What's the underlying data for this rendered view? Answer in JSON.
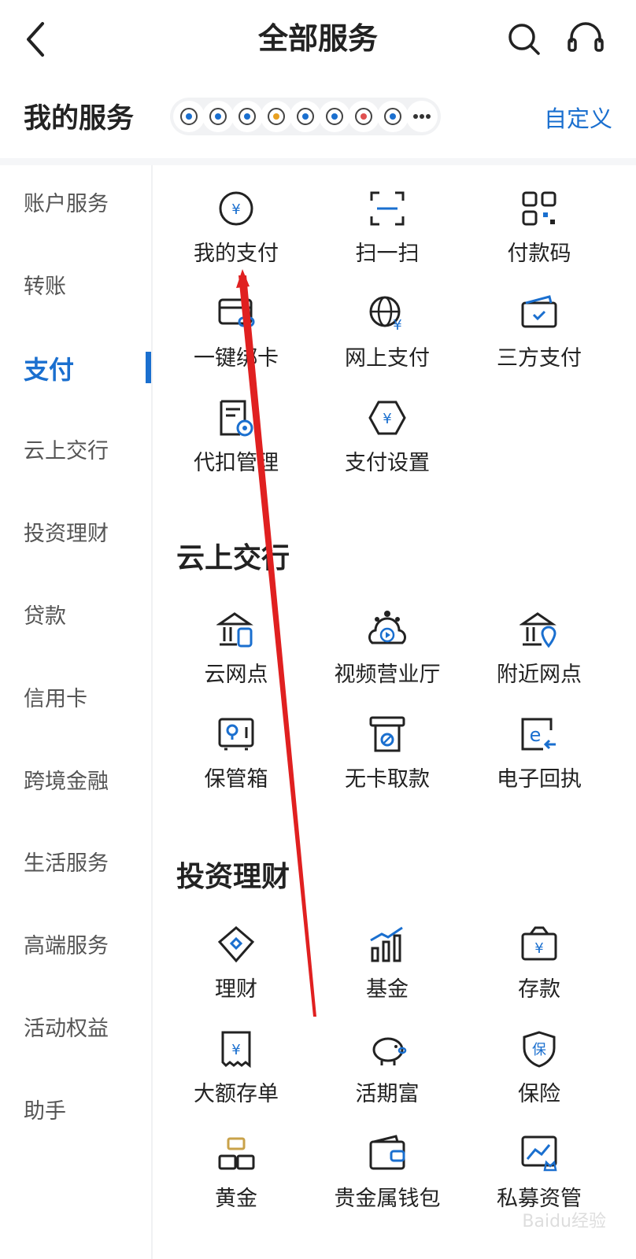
{
  "header": {
    "title": "全部服务",
    "back_icon": "chevron-left-icon",
    "search_icon": "search-icon",
    "service_icon": "headset-icon"
  },
  "my_services": {
    "label": "我的服务",
    "customize": "自定义",
    "icons": [
      "transfer-icon",
      "hand-yen-icon",
      "card-icon",
      "drop-yen-icon",
      "document-icon",
      "tree-yen-icon",
      "balloon-icon",
      "link-card-icon",
      "more-icon"
    ]
  },
  "sidebar": {
    "items": [
      {
        "label": "账户服务"
      },
      {
        "label": "转账"
      },
      {
        "label": "支付"
      },
      {
        "label": "云上交行"
      },
      {
        "label": "投资理财"
      },
      {
        "label": "贷款"
      },
      {
        "label": "信用卡"
      },
      {
        "label": "跨境金融"
      },
      {
        "label": "生活服务"
      },
      {
        "label": "高端服务"
      },
      {
        "label": "活动权益"
      },
      {
        "label": "助手"
      }
    ],
    "active_index": 2
  },
  "payment": {
    "items": [
      {
        "label": "我的支付",
        "icon": "yen-circle-icon"
      },
      {
        "label": "扫一扫",
        "icon": "scan-icon"
      },
      {
        "label": "付款码",
        "icon": "qr-code-icon"
      },
      {
        "label": "一键绑卡",
        "icon": "bind-card-icon"
      },
      {
        "label": "网上支付",
        "icon": "globe-yen-icon"
      },
      {
        "label": "三方支付",
        "icon": "wallet-check-icon"
      },
      {
        "label": "代扣管理",
        "icon": "doc-gear-icon"
      },
      {
        "label": "支付设置",
        "icon": "hexagon-yen-icon"
      }
    ]
  },
  "cloud": {
    "title": "云上交行",
    "items": [
      {
        "label": "云网点",
        "icon": "bank-phone-icon"
      },
      {
        "label": "视频营业厅",
        "icon": "cloud-video-icon"
      },
      {
        "label": "附近网点",
        "icon": "bank-location-icon"
      },
      {
        "label": "保管箱",
        "icon": "safe-box-icon"
      },
      {
        "label": "无卡取款",
        "icon": "atm-icon"
      },
      {
        "label": "电子回执",
        "icon": "e-receipt-icon"
      }
    ]
  },
  "invest": {
    "title": "投资理财",
    "items": [
      {
        "label": "理财",
        "icon": "diamond-icon"
      },
      {
        "label": "基金",
        "icon": "bar-chart-icon"
      },
      {
        "label": "存款",
        "icon": "deposit-box-icon"
      },
      {
        "label": "大额存单",
        "icon": "receipt-yen-icon"
      },
      {
        "label": "活期富",
        "icon": "piggy-bank-icon"
      },
      {
        "label": "保险",
        "icon": "shield-bao-icon"
      },
      {
        "label": "黄金",
        "icon": "gold-bars-icon"
      },
      {
        "label": "贵金属钱包",
        "icon": "wallet-icon"
      },
      {
        "label": "私募资管",
        "icon": "chart-crown-icon"
      }
    ]
  },
  "colors": {
    "accent": "#1a6fcf",
    "text": "#222222",
    "annotation": "#e02020"
  },
  "watermark": "Baidu经验"
}
